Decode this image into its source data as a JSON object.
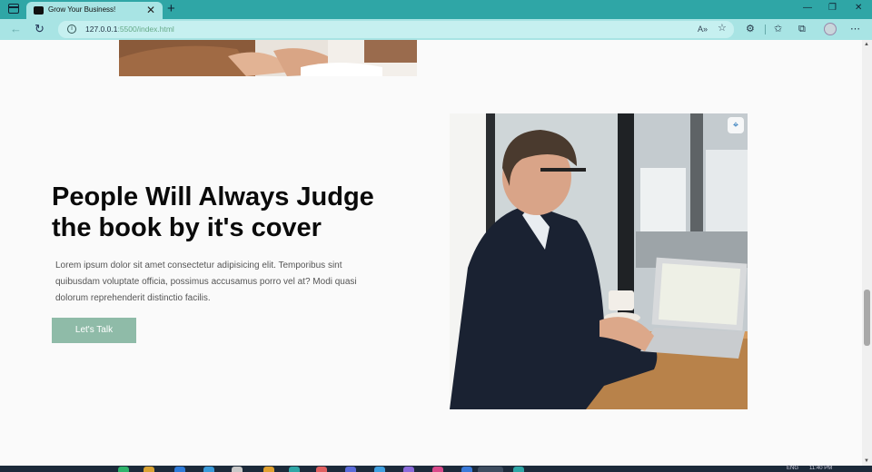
{
  "browser": {
    "tab_title": "Grow Your Business!",
    "tab_close": "✕",
    "new_tab": "+",
    "url_host": "127.0.0.1",
    "url_rest": ":5500/index.html",
    "window_controls": [
      "—",
      "❐",
      "✕"
    ],
    "icons": {
      "read_aloud": "A»",
      "favorite": "☆",
      "extensions": "⚙",
      "favorites": "✩",
      "collections": "⧉",
      "more": "⋯"
    }
  },
  "hero": {
    "headline": "People Will Always Judge the book by it's cover",
    "body": "Lorem ipsum dolor sit amet consectetur adipisicing elit. Temporibus sint quibusdam voluptate officia, possimus accusamus porro vel at? Modi quasi dolorum reprehenderit distinctio facilis.",
    "cta_label": "Let's Talk"
  },
  "taskbar": {
    "lang": "ENG",
    "time": "11:40 PM"
  },
  "colors": {
    "titlebar": "#2fa6a6",
    "toolbar": "#a8e4e4",
    "cta": "#8fbba8"
  }
}
